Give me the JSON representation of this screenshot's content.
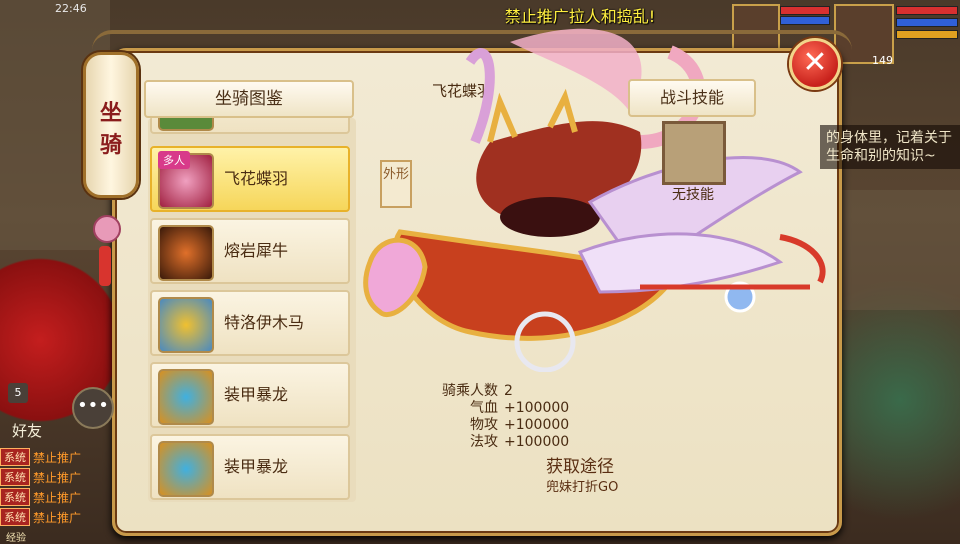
{
  "status_bar": {
    "time": "22:46"
  },
  "notice": "禁止推广拉人和捣乱!",
  "player": {
    "level": "149"
  },
  "lantern": {
    "title_line1": "坐",
    "title_line2": "骑"
  },
  "close_label": "✕",
  "catalog": {
    "title": "坐骑图鉴",
    "items": [
      {
        "name": "飞花蝶羽",
        "badge": "多人",
        "selected": true
      },
      {
        "name": "熔岩犀牛",
        "badge": "",
        "selected": false
      },
      {
        "name": "特洛伊木马",
        "badge": "",
        "selected": false
      },
      {
        "name": "装甲暴龙",
        "badge": "",
        "selected": false
      },
      {
        "name": "装甲暴龙",
        "badge": "",
        "selected": false
      }
    ]
  },
  "detail": {
    "mount_name": "飞花蝶羽",
    "appearance_tag": "外形",
    "skill_tab": "战斗技能",
    "no_skill": "无技能",
    "stats": [
      {
        "label": "骑乘人数",
        "value": "2"
      },
      {
        "label": "气血",
        "value": "+100000"
      },
      {
        "label": "物攻",
        "value": "+100000"
      },
      {
        "label": "法攻",
        "value": "+100000"
      }
    ],
    "get_way_label": "获取途径",
    "get_way_value": "兜妹打折GO"
  },
  "side_text": "的身体里，记着关于生命和别的知识~",
  "chat": {
    "badge_count": "5",
    "friends_label": "好友",
    "lines": [
      {
        "tag": "系统",
        "text": "禁止推广"
      },
      {
        "tag": "系统",
        "text": "禁止推广"
      },
      {
        "tag": "系统",
        "text": "禁止推广"
      },
      {
        "tag": "系统",
        "text": "禁止推广"
      }
    ],
    "bottom_label": "经验"
  },
  "colors": {
    "panel_bg": "#f2ead4",
    "selected_item": "#f6d65a",
    "close_red": "#c8221c",
    "notice_yellow": "#ffef40"
  }
}
